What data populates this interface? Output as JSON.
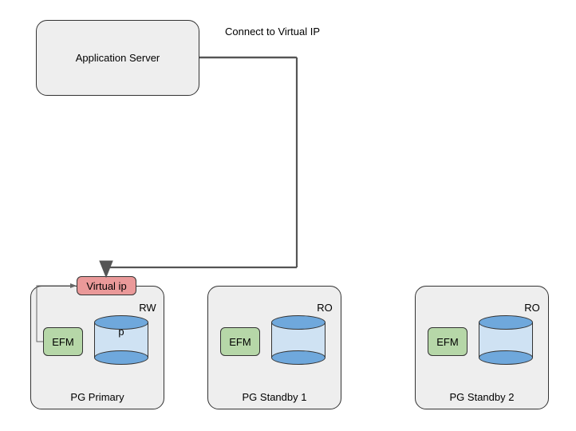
{
  "connect_label": "Connect to Virtual IP",
  "app_server": {
    "label": "Application Server"
  },
  "virtual_ip": {
    "label": "Virtual ip"
  },
  "efm_label": "EFM",
  "nodes": [
    {
      "name": "PG Primary",
      "mode": "RW",
      "db_label": "p"
    },
    {
      "name": "PG Standby 1",
      "mode": "RO",
      "db_label": ""
    },
    {
      "name": "PG Standby 2",
      "mode": "RO",
      "db_label": ""
    }
  ],
  "colors": {
    "node_bg": "#eeeeee",
    "vip_bg": "#ea9999",
    "efm_bg": "#b6d7a8",
    "cylinder_side": "#cfe2f3",
    "cylinder_cap": "#6fa8dc"
  }
}
